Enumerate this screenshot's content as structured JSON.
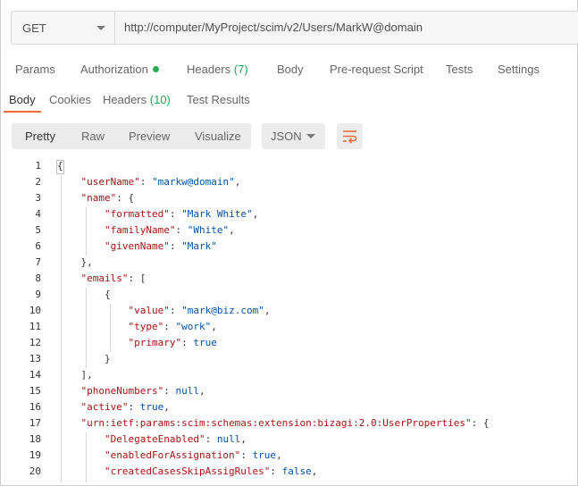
{
  "request": {
    "method": "GET",
    "url": "http://computer/MyProject/scim/v2/Users/MarkW@domain"
  },
  "request_tabs": [
    {
      "label": "Params"
    },
    {
      "label": "Authorization"
    },
    {
      "label": "Headers",
      "count": "(7)"
    },
    {
      "label": "Body"
    },
    {
      "label": "Pre-request Script"
    },
    {
      "label": "Tests"
    },
    {
      "label": "Settings"
    }
  ],
  "response_tabs": [
    {
      "label": "Body"
    },
    {
      "label": "Cookies"
    },
    {
      "label": "Headers",
      "count": "(10)"
    },
    {
      "label": "Test Results"
    }
  ],
  "view_modes": [
    "Pretty",
    "Raw",
    "Preview",
    "Visualize"
  ],
  "format": "JSON",
  "icons": {
    "method_dropdown": "chevron-down-icon",
    "authorization_status": "green-dot-icon",
    "format_dropdown": "chevron-down-icon",
    "wrap": "wrap-lines-icon"
  },
  "colors": {
    "accent": "#f26b3a",
    "status_dot": "#26b052",
    "key": "#a31515",
    "value": "#0451a5"
  },
  "code_lines": [
    {
      "n": "1",
      "parts": [
        [
          "p",
          "{"
        ]
      ]
    },
    {
      "n": "2",
      "parts": [
        [
          "p",
          "    "
        ],
        [
          "k",
          "\"userName\""
        ],
        [
          "p",
          ": "
        ],
        [
          "s",
          "\"markw@domain\""
        ],
        [
          "p",
          ","
        ]
      ]
    },
    {
      "n": "3",
      "parts": [
        [
          "p",
          "    "
        ],
        [
          "k",
          "\"name\""
        ],
        [
          "p",
          ": {"
        ]
      ]
    },
    {
      "n": "4",
      "parts": [
        [
          "p",
          "        "
        ],
        [
          "k",
          "\"formatted\""
        ],
        [
          "p",
          ": "
        ],
        [
          "s",
          "\"Mark White\""
        ],
        [
          "p",
          ","
        ]
      ]
    },
    {
      "n": "5",
      "parts": [
        [
          "p",
          "        "
        ],
        [
          "k",
          "\"familyName\""
        ],
        [
          "p",
          ": "
        ],
        [
          "s",
          "\"White\""
        ],
        [
          "p",
          ","
        ]
      ]
    },
    {
      "n": "6",
      "parts": [
        [
          "p",
          "        "
        ],
        [
          "k",
          "\"givenName\""
        ],
        [
          "p",
          ": "
        ],
        [
          "s",
          "\"Mark\""
        ]
      ]
    },
    {
      "n": "7",
      "parts": [
        [
          "p",
          "    },"
        ]
      ]
    },
    {
      "n": "8",
      "parts": [
        [
          "p",
          "    "
        ],
        [
          "k",
          "\"emails\""
        ],
        [
          "p",
          ": ["
        ]
      ]
    },
    {
      "n": "9",
      "parts": [
        [
          "p",
          "        {"
        ]
      ]
    },
    {
      "n": "10",
      "parts": [
        [
          "p",
          "            "
        ],
        [
          "k",
          "\"value\""
        ],
        [
          "p",
          ": "
        ],
        [
          "s",
          "\"mark@biz.com\""
        ],
        [
          "p",
          ","
        ]
      ]
    },
    {
      "n": "11",
      "parts": [
        [
          "p",
          "            "
        ],
        [
          "k",
          "\"type\""
        ],
        [
          "p",
          ": "
        ],
        [
          "s",
          "\"work\""
        ],
        [
          "p",
          ","
        ]
      ]
    },
    {
      "n": "12",
      "parts": [
        [
          "p",
          "            "
        ],
        [
          "k",
          "\"primary\""
        ],
        [
          "p",
          ": "
        ],
        [
          "v",
          "true"
        ]
      ]
    },
    {
      "n": "13",
      "parts": [
        [
          "p",
          "        }"
        ]
      ]
    },
    {
      "n": "14",
      "parts": [
        [
          "p",
          "    ],"
        ]
      ]
    },
    {
      "n": "15",
      "parts": [
        [
          "p",
          "    "
        ],
        [
          "k",
          "\"phoneNumbers\""
        ],
        [
          "p",
          ": "
        ],
        [
          "v",
          "null"
        ],
        [
          "p",
          ","
        ]
      ]
    },
    {
      "n": "16",
      "parts": [
        [
          "p",
          "    "
        ],
        [
          "k",
          "\"active\""
        ],
        [
          "p",
          ": "
        ],
        [
          "v",
          "true"
        ],
        [
          "p",
          ","
        ]
      ]
    },
    {
      "n": "17",
      "parts": [
        [
          "p",
          "    "
        ],
        [
          "k",
          "\"urn:ietf:params:scim:schemas:extension:bizagi:2.0:UserProperties\""
        ],
        [
          "p",
          ": {"
        ]
      ]
    },
    {
      "n": "18",
      "parts": [
        [
          "p",
          "        "
        ],
        [
          "k",
          "\"DelegateEnabled\""
        ],
        [
          "p",
          ": "
        ],
        [
          "v",
          "null"
        ],
        [
          "p",
          ","
        ]
      ]
    },
    {
      "n": "19",
      "parts": [
        [
          "p",
          "        "
        ],
        [
          "k",
          "\"enabledForAssignation\""
        ],
        [
          "p",
          ": "
        ],
        [
          "v",
          "true"
        ],
        [
          "p",
          ","
        ]
      ]
    },
    {
      "n": "20",
      "parts": [
        [
          "p",
          "        "
        ],
        [
          "k",
          "\"createdCasesSkipAssigRules\""
        ],
        [
          "p",
          ": "
        ],
        [
          "v",
          "false"
        ],
        [
          "p",
          ","
        ]
      ]
    }
  ]
}
